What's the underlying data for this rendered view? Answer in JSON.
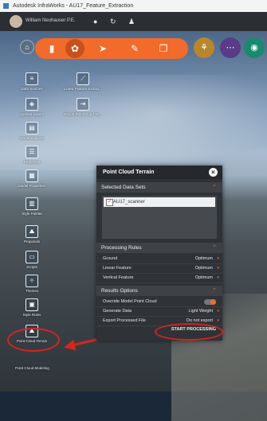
{
  "window": {
    "title": "Autodesk InfraWorks - AU17_Feature_Extraction"
  },
  "header": {
    "username": "William Neuhauser P.E.",
    "icons": [
      "settings-gear-icon",
      "sync-icon",
      "user-icon"
    ]
  },
  "toolbar": {
    "buttons": [
      "home-icon",
      "model-tools-icon",
      "settings-gear-icon",
      "select-cursor-icon",
      "sketch-pen-icon",
      "layers-icon"
    ],
    "right_buttons": [
      "terrain-tool-icon",
      "overlay-tool-icon",
      "view-tool-icon"
    ]
  },
  "left_tools": [
    {
      "label": "Data Sources",
      "icon": "database-icon"
    },
    {
      "label": "Linear Feature Extract...",
      "icon": "linear-feature-icon"
    },
    {
      "label": "Surface Layers",
      "icon": "surface-layers-icon"
    },
    {
      "label": "Export Point Cloud Te...",
      "icon": "export-icon"
    },
    {
      "label": "Model Explorer",
      "icon": "model-explorer-icon"
    },
    {
      "label": "Properties",
      "icon": "properties-icon"
    },
    {
      "label": "Model Properties",
      "icon": "model-properties-icon"
    },
    {
      "label": "Style Palette",
      "icon": "style-palette-icon"
    },
    {
      "label": "Proposals",
      "icon": "proposals-icon"
    },
    {
      "label": "Scripts",
      "icon": "scripts-icon"
    },
    {
      "label": "Themes",
      "icon": "themes-icon"
    },
    {
      "label": "Style Rules",
      "icon": "style-rules-icon"
    },
    {
      "label": "Point Cloud Terrain",
      "icon": "point-cloud-terrain-icon"
    }
  ],
  "bottom_label": "Point Cloud Modeling",
  "panel": {
    "title": "Point Cloud Terrain",
    "sections": {
      "selected": "Selected Data Sets",
      "processing": "Processing Rules",
      "results": "Results Options"
    },
    "datasets": [
      "AU17_scanner"
    ],
    "processing_rules": [
      {
        "label": "Ground",
        "value": "Optimum"
      },
      {
        "label": "Linear Feature",
        "value": "Optimum"
      },
      {
        "label": "Vertical Feature",
        "value": "Optimum"
      }
    ],
    "results_options": [
      {
        "label": "Override Model Point Cloud",
        "value": ""
      },
      {
        "label": "Generate Data",
        "value": "Light Weight"
      },
      {
        "label": "Export Processed File",
        "value": "Do not export"
      }
    ],
    "start_label": "START PROCESSING"
  },
  "colors": {
    "accent": "#f26b2a",
    "annotation": "#d9231d"
  }
}
